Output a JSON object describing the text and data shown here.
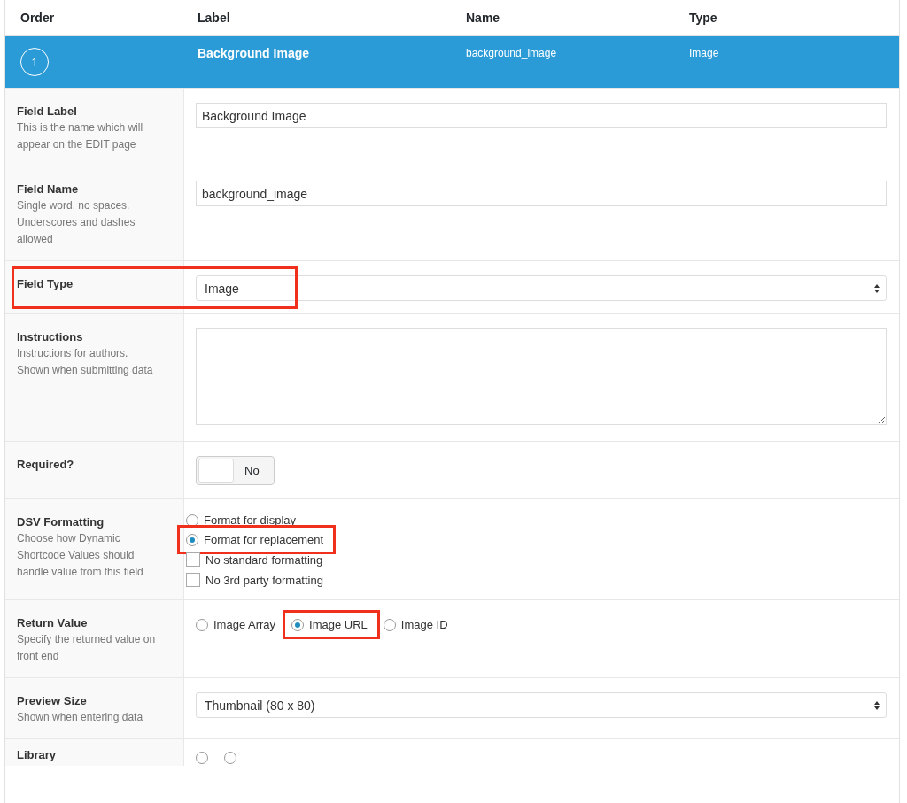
{
  "columns": [
    "Order",
    "Label",
    "Name",
    "Type"
  ],
  "field_row": {
    "order": "1",
    "label": "Background Image",
    "name": "background_image",
    "type": "Image",
    "selected": true
  },
  "settings": [
    {
      "kind": "text",
      "label": "Field Label",
      "help": "This is the name which will appear on the EDIT page",
      "value": "Background Image"
    },
    {
      "kind": "text",
      "label": "Field Name",
      "help": "Single word, no spaces. Underscores and dashes allowed",
      "value": "background_image"
    },
    {
      "kind": "select",
      "label": "Field Type",
      "value": "Image",
      "highlighted": true
    },
    {
      "kind": "textarea",
      "label": "Instructions",
      "help": "Instructions for authors. Shown when submitting data"
    },
    {
      "kind": "toggle",
      "label": "Required?",
      "value": "No",
      "on": false
    },
    {
      "kind": "stack",
      "label": "DSV Formatting",
      "help": "Choose how Dynamic Shortcode Values should handle value from this field",
      "options": [
        {
          "kind": "radio",
          "label": "Format for display",
          "selected": false
        },
        {
          "kind": "radio",
          "label": "Format for replacement",
          "selected": true,
          "highlighted": true
        },
        {
          "kind": "checkbox",
          "label": "No standard formatting",
          "checked": false
        },
        {
          "kind": "checkbox",
          "label": "No 3rd party formatting",
          "checked": false
        }
      ]
    },
    {
      "kind": "inline",
      "label": "Return Value",
      "help": "Specify the returned value on front end",
      "options": [
        {
          "kind": "radio",
          "label": "Image Array",
          "selected": false
        },
        {
          "kind": "radio",
          "label": "Image URL",
          "selected": true,
          "highlighted": true
        },
        {
          "kind": "radio",
          "label": "Image ID",
          "selected": false
        }
      ]
    },
    {
      "kind": "select",
      "label": "Preview Size",
      "help": "Shown when entering data",
      "value": "Thumbnail (80 x 80)"
    },
    {
      "kind": "cut",
      "label": "Library",
      "options": [
        {
          "selected": false
        },
        {
          "selected": false
        }
      ]
    }
  ]
}
